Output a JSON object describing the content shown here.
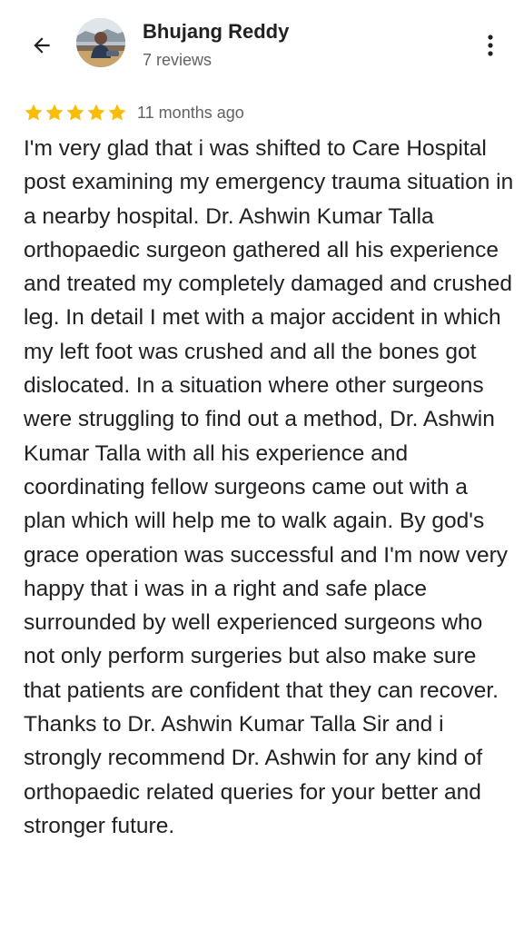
{
  "header": {
    "reviewer_name": "Bhujang Reddy",
    "reviews_count": "7 reviews",
    "icons": {
      "back": "arrow-left-icon",
      "more": "more-vert-icon"
    }
  },
  "review": {
    "rating": 5,
    "max_rating": 5,
    "star_color": "#fbbc04",
    "time_ago": "11 months ago",
    "text": "I'm very glad that i was shifted to Care Hospital post examining my emergency trauma situation in a nearby hospital. Dr. Ashwin Kumar Talla orthopaedic surgeon gathered all his experience and treated my completely damaged and crushed leg. In detail I met with a major accident in which my left foot was crushed and all the bones got dislocated. In a situation where other surgeons were struggling to find out a method, Dr. Ashwin Kumar Talla with all his experience and coordinating fellow surgeons came out with a plan which will help me to walk again. By god's grace operation was successful and I'm now very happy that i was in a right and safe place surrounded by well experienced surgeons who not only perform surgeries but also make sure that patients are confident that they can recover. Thanks to Dr. Ashwin Kumar Talla Sir and i strongly recommend Dr. Ashwin for any kind of orthopaedic related queries for your better and stronger future."
  }
}
